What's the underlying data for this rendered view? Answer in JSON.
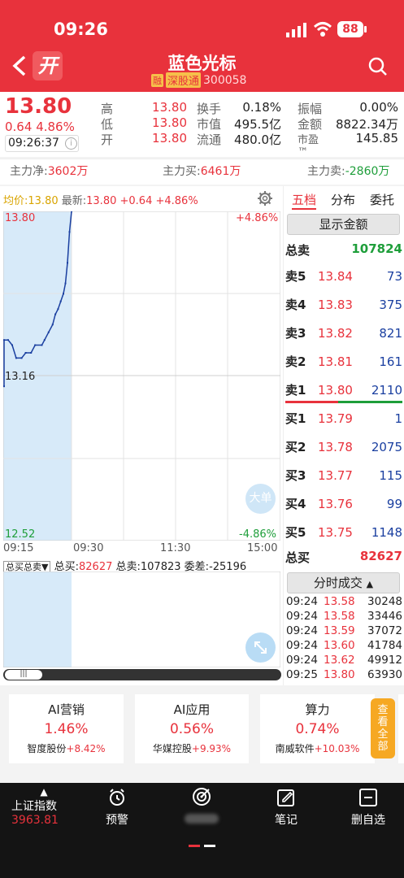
{
  "status": {
    "time": "09:26",
    "battery": "88"
  },
  "header": {
    "open_badge": "开",
    "title": "蓝色光标",
    "rong_badge": "融",
    "connect_badge": "深股通",
    "code": "300058"
  },
  "quote": {
    "price": "13.80",
    "change": "0.64",
    "change_pct": "4.86%",
    "time": "09:26:37",
    "stats": [
      {
        "l1": "高",
        "v1": "13.80",
        "l2": "换手",
        "v2": "0.18%",
        "l3": "振幅",
        "v3": "0.00%"
      },
      {
        "l1": "低",
        "v1": "13.80",
        "l2": "市值",
        "v2": "495.5亿",
        "l3": "金额",
        "v3": "8822.34万"
      },
      {
        "l1": "开",
        "v1": "13.80",
        "l2": "流通",
        "v2": "480.0亿",
        "l3": "市盈™",
        "v3": "145.85"
      }
    ]
  },
  "flow": {
    "net_label": "主力净:",
    "net": "3602万",
    "buy_label": "主力买:",
    "buy": "6461万",
    "sell_label": "主力卖:",
    "sell": "-2860万"
  },
  "chart_header": {
    "avg_label": "均价:",
    "avg": "13.80",
    "latest_label": "最新:",
    "latest": "13.80",
    "chg": "+0.64",
    "pct": "+4.86%"
  },
  "chart_data": {
    "type": "line",
    "y_high": "13.80",
    "y_mid": "13.16",
    "y_low": "12.52",
    "pct_high": "+4.86%",
    "pct_low": "-4.86%",
    "x_labels": [
      "09:15",
      "09:30",
      "11:30",
      "15:00"
    ],
    "ylim": [
      12.52,
      13.8
    ],
    "auction_series": [
      {
        "t": 0,
        "v": 13.12
      },
      {
        "t": 0,
        "v": 13.3
      },
      {
        "t": 0.3,
        "v": 13.3
      },
      {
        "t": 0.6,
        "v": 13.28
      },
      {
        "t": 0.9,
        "v": 13.23
      },
      {
        "t": 1.3,
        "v": 13.23
      },
      {
        "t": 1.6,
        "v": 13.25
      },
      {
        "t": 2.0,
        "v": 13.25
      },
      {
        "t": 2.3,
        "v": 13.28
      },
      {
        "t": 2.8,
        "v": 13.28
      },
      {
        "t": 3.0,
        "v": 13.3
      },
      {
        "t": 3.3,
        "v": 13.33
      },
      {
        "t": 3.6,
        "v": 13.36
      },
      {
        "t": 3.8,
        "v": 13.4
      },
      {
        "t": 4.0,
        "v": 13.42
      },
      {
        "t": 4.2,
        "v": 13.45
      },
      {
        "t": 4.4,
        "v": 13.48
      },
      {
        "t": 4.55,
        "v": 13.52
      },
      {
        "t": 4.7,
        "v": 13.6
      },
      {
        "t": 4.85,
        "v": 13.72
      },
      {
        "t": 5.0,
        "v": 13.8
      }
    ],
    "big_order_label": "大单",
    "volume": {
      "selector": "总买总卖",
      "buy_label": "总买:",
      "buy": "82627",
      "sell_label": "总卖:",
      "sell": "107823",
      "diff_label": "委差:",
      "diff": "-25196"
    }
  },
  "orderbook": {
    "tabs": [
      "五档",
      "分布",
      "委托"
    ],
    "show_amount": "显示金额",
    "total_sell_label": "总卖",
    "total_sell": "107824",
    "asks": [
      {
        "label": "卖5",
        "price": "13.84",
        "vol": "73"
      },
      {
        "label": "卖4",
        "price": "13.83",
        "vol": "375"
      },
      {
        "label": "卖3",
        "price": "13.82",
        "vol": "821"
      },
      {
        "label": "卖2",
        "price": "13.81",
        "vol": "161"
      },
      {
        "label": "卖1",
        "price": "13.80",
        "vol": "2110"
      }
    ],
    "bids": [
      {
        "label": "买1",
        "price": "13.79",
        "vol": "1"
      },
      {
        "label": "买2",
        "price": "13.78",
        "vol": "2075"
      },
      {
        "label": "买3",
        "price": "13.77",
        "vol": "115"
      },
      {
        "label": "买4",
        "price": "13.76",
        "vol": "99"
      },
      {
        "label": "买5",
        "price": "13.75",
        "vol": "1148"
      }
    ],
    "total_buy_label": "总买",
    "total_buy": "82627",
    "ticks_button": "分时成交",
    "ticks": [
      {
        "t": "09:24",
        "p": "13.58",
        "v": "30248"
      },
      {
        "t": "09:24",
        "p": "13.58",
        "v": "33446"
      },
      {
        "t": "09:24",
        "p": "13.59",
        "v": "37072"
      },
      {
        "t": "09:24",
        "p": "13.60",
        "v": "41784"
      },
      {
        "t": "09:24",
        "p": "13.62",
        "v": "49912"
      },
      {
        "t": "09:25",
        "p": "13.80",
        "v": "63930"
      }
    ]
  },
  "sectors": [
    {
      "name": "AI营销",
      "pct": "1.46%",
      "stock": "智度股份",
      "stock_pct": "+8.42%"
    },
    {
      "name": "AI应用",
      "pct": "0.56%",
      "stock": "华媒控股",
      "stock_pct": "+9.93%"
    },
    {
      "name": "算力",
      "pct": "0.74%",
      "stock": "南威软件",
      "stock_pct": "+10.03%"
    }
  ],
  "view_all": "查看全部",
  "bottom_nav": {
    "index_name": "上证指数",
    "index_value": "3963.81",
    "alert": "预警",
    "notes": "笔记",
    "remove": "删自选"
  },
  "colors": {
    "brand": "#e8323c",
    "up": "#e8323c",
    "down": "#1e9e3a",
    "blue": "#1a3fa0"
  }
}
